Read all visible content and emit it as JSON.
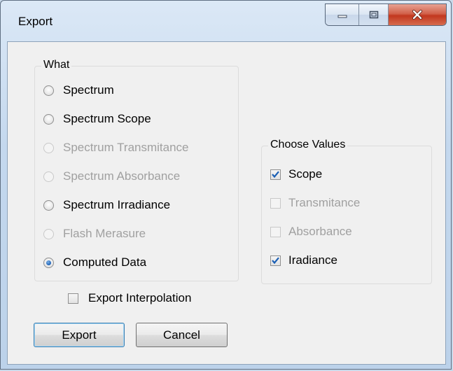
{
  "window": {
    "title": "Export",
    "controls": {
      "minimize": "minimize-icon",
      "maximize": "maximize-icon",
      "close": "close-icon"
    }
  },
  "what_group": {
    "title": "What",
    "options": [
      {
        "label": "Spectrum",
        "checked": false,
        "enabled": true
      },
      {
        "label": "Spectrum Scope",
        "checked": false,
        "enabled": true
      },
      {
        "label": "Spectrum Transmitance",
        "checked": false,
        "enabled": false
      },
      {
        "label": "Spectrum Absorbance",
        "checked": false,
        "enabled": false
      },
      {
        "label": "Spectrum Irradiance",
        "checked": false,
        "enabled": true
      },
      {
        "label": "Flash Merasure",
        "checked": false,
        "enabled": false
      },
      {
        "label": "Computed Data",
        "checked": true,
        "enabled": true
      }
    ]
  },
  "values_group": {
    "title": "Choose Values",
    "options": [
      {
        "label": "Scope",
        "checked": true,
        "enabled": true
      },
      {
        "label": "Transmitance",
        "checked": false,
        "enabled": false
      },
      {
        "label": "Absorbance",
        "checked": false,
        "enabled": false
      },
      {
        "label": "Iradiance",
        "checked": true,
        "enabled": true
      }
    ]
  },
  "export_interpolation": {
    "label": "Export Interpolation",
    "checked": false
  },
  "buttons": {
    "export_label": "Export",
    "cancel_label": "Cancel"
  },
  "colors": {
    "accent_check": "#1b5fb4",
    "disabled_text": "#a0a0a0"
  }
}
